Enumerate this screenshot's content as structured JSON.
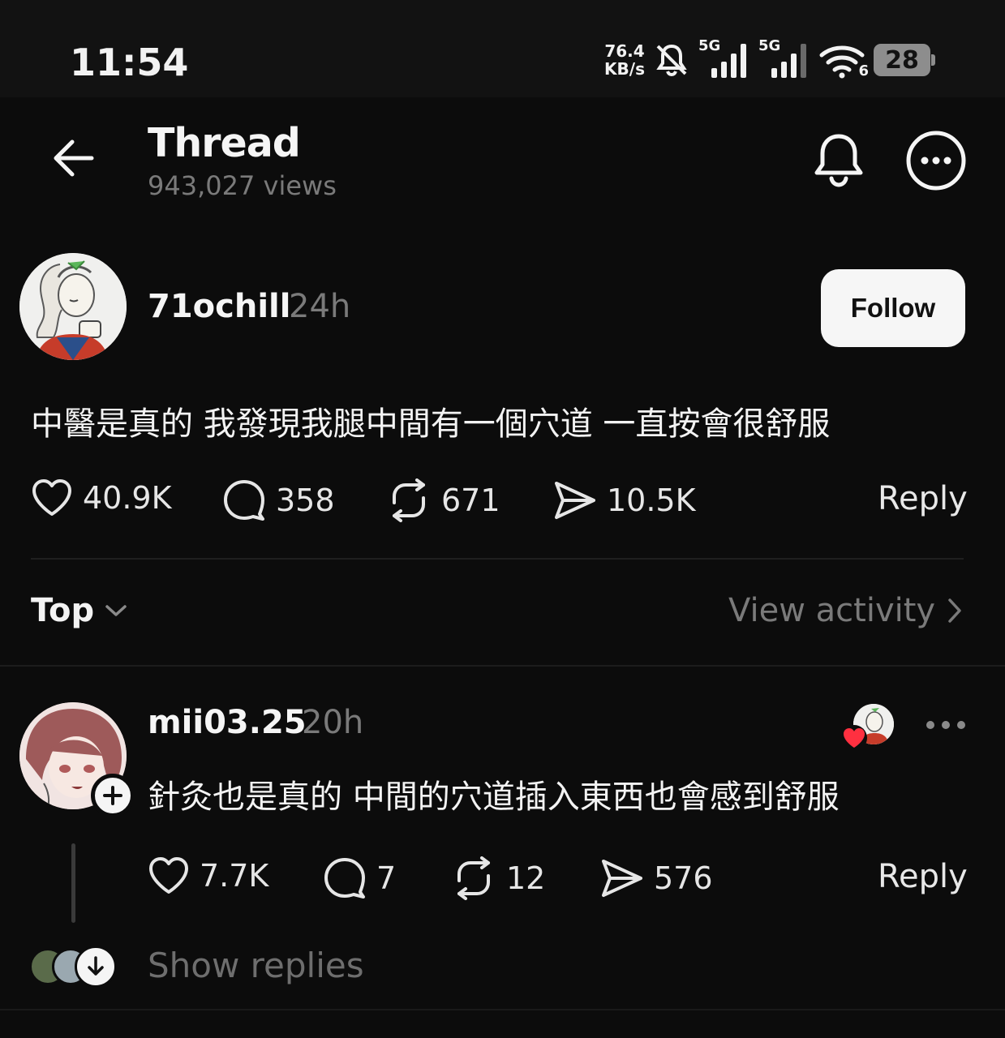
{
  "status_bar": {
    "time": "11:54",
    "net_speed_value": "76.4",
    "net_speed_unit": "KB/s",
    "sim1_label": "5G",
    "sim2_label": "5G",
    "wifi_label": "6",
    "battery": "28",
    "icons": [
      "bell-muted-icon",
      "signal-icon",
      "signal-icon",
      "wifi-icon",
      "battery-icon"
    ]
  },
  "header": {
    "title": "Thread",
    "views": "943,027 views",
    "icons": [
      "back-arrow-icon",
      "bell-icon",
      "more-circle-icon"
    ]
  },
  "post": {
    "username": "71ochill",
    "time": "24h",
    "follow_label": "Follow",
    "text": "中醫是真的 我發現我腿中間有一個穴道 一直按會很舒服",
    "likes": "40.9K",
    "comments": "358",
    "reposts": "671",
    "shares": "10.5K",
    "reply_label": "Reply"
  },
  "sort": {
    "label": "Top",
    "view_activity": "View activity"
  },
  "comment": {
    "username": "mii03.25",
    "time": "20h",
    "text": "針灸也是真的 中間的穴道插入東西也會感到舒服",
    "likes": "7.7K",
    "comments": "7",
    "reposts": "12",
    "shares": "576",
    "reply_label": "Reply",
    "show_replies": "Show replies",
    "liked_by_author": true
  },
  "colors": {
    "background": "#0c0c0c",
    "text": "#f3f3f3",
    "muted": "#7a7a7a",
    "heart": "#ff3040",
    "follow_bg": "#f6f6f6"
  }
}
